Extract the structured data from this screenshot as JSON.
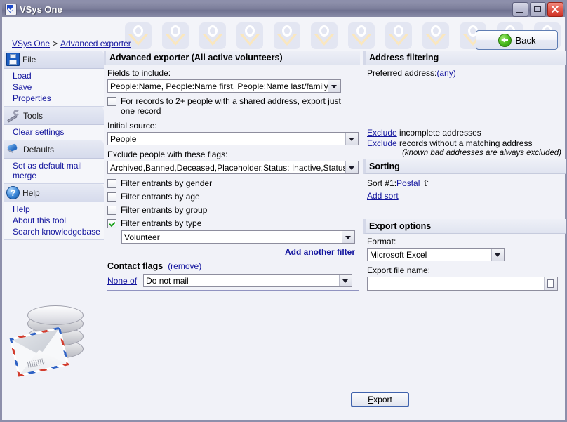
{
  "window": {
    "title": "VSys One",
    "minimize_label": "Minimize",
    "maximize_label": "Maximize",
    "close_label": "Close"
  },
  "breadcrumb": {
    "root": "VSys One",
    "separator": ">",
    "current": "Advanced exporter"
  },
  "back_button": {
    "label": "Back",
    "icon": "back-arrow-icon"
  },
  "sidebar": {
    "groups": [
      {
        "icon": "floppy-disk-icon",
        "title": "File",
        "items": [
          "Load",
          "Save",
          "Properties"
        ]
      },
      {
        "icon": "wrench-icon",
        "title": "Tools",
        "items": [
          "Clear settings"
        ]
      },
      {
        "icon": "pushpin-icon",
        "title": "Defaults",
        "items": [
          "Set as default mail merge"
        ]
      },
      {
        "icon": "question-mark-icon",
        "title": "Help",
        "items": [
          "Help",
          "About this tool",
          "Search knowledgebase"
        ]
      }
    ],
    "artwork": "database-mail-icon"
  },
  "main": {
    "title": "Advanced exporter (All active volunteers)",
    "fields_to_include": {
      "label": "Fields to include:",
      "value": "People:Name, People:Name first, People:Name last/family, Addr"
    },
    "shared_address_checkbox": {
      "label": "For records to 2+ people with a shared address, export just one record",
      "checked": false
    },
    "initial_source": {
      "label": "Initial source:",
      "value": "People"
    },
    "exclude_flags": {
      "label": "Exclude people with these flags:",
      "value": "Archived,Banned,Deceased,Placeholder,Status: Inactive,Status: Pro"
    },
    "filters": [
      {
        "label": "Filter entrants by gender",
        "checked": false
      },
      {
        "label": "Filter entrants by age",
        "checked": false
      },
      {
        "label": "Filter entrants by group",
        "checked": false
      },
      {
        "label": "Filter entrants by type",
        "checked": true
      }
    ],
    "filter_type_value": "Volunteer",
    "add_another_filter": "Add another filter",
    "contact_flags": {
      "title": "Contact flags",
      "remove": "(remove)",
      "operator": "None of",
      "value": "Do not mail"
    }
  },
  "address_filtering": {
    "title": "Address filtering",
    "preferred_label": "Preferred address:",
    "preferred_value": "(any)",
    "exclude_link": "Exclude",
    "exclude_incomplete_rest": " incomplete addresses",
    "exclude_nomatch_rest": " records without a matching address",
    "note": "(known bad addresses are always excluded)"
  },
  "sorting": {
    "title": "Sorting",
    "sort1_label": "Sort #1:",
    "sort1_value": "Postal",
    "sort1_direction": "⇧",
    "add_sort": "Add sort"
  },
  "export_options": {
    "title": "Export options",
    "format_label": "Format:",
    "format_value": "Microsoft Excel",
    "file_label": "Export file name:",
    "file_value": "",
    "browse_icon": "document-browse-icon"
  },
  "export_button": {
    "accel": "E",
    "rest": "xport"
  },
  "colors": {
    "link": "#13159e",
    "titlebar": "#7c7e9b",
    "section_header": "#e4e8f2",
    "check_green": "#18a018",
    "accent_border": "#4063ad"
  }
}
